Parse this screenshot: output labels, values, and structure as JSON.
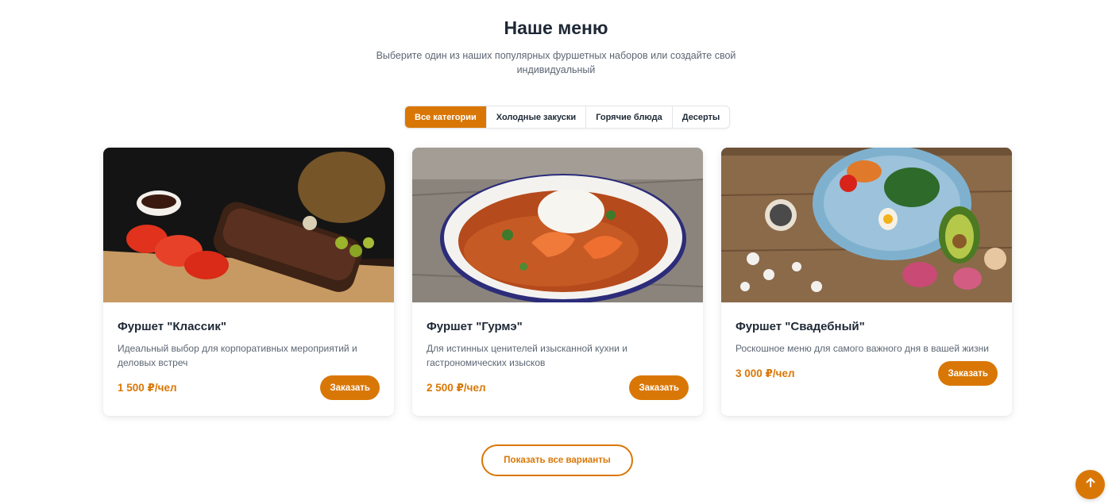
{
  "header": {
    "title": "Наше меню",
    "subtitle": "Выберите один из наших популярных фуршетных наборов или создайте свой индивидуальный"
  },
  "tabs": [
    {
      "label": "Все категории",
      "active": true
    },
    {
      "label": "Холодные закуски",
      "active": false
    },
    {
      "label": "Горячие блюда",
      "active": false
    },
    {
      "label": "Десерты",
      "active": false
    }
  ],
  "cards": [
    {
      "title": "Фуршет \"Классик\"",
      "description": "Идеальный выбор для корпоративных мероприятий и деловых встреч",
      "price": "1 500 ₽/чел",
      "button": "Заказать",
      "image": "grilled-ribs-with-tomatoes-photo"
    },
    {
      "title": "Фуршет \"Гурмэ\"",
      "description": "Для истинных ценителей изысканной кухни и гастрономических изысков",
      "price": "2 500 ₽/чел",
      "button": "Заказать",
      "image": "shrimp-curry-with-rice-photo"
    },
    {
      "title": "Фуршет \"Свадебный\"",
      "description": "Роскошное меню для самого важного дня в вашей жизни",
      "price": "3 000 ₽/чел",
      "button": "Заказать",
      "image": "salad-bowl-with-egg-and-avocado-photo"
    }
  ],
  "show_all_label": "Показать все варианты",
  "scroll_top_icon": "arrow-up-icon",
  "colors": {
    "accent": "#d97706",
    "heading": "#1e2836",
    "muted": "#5d6673"
  }
}
